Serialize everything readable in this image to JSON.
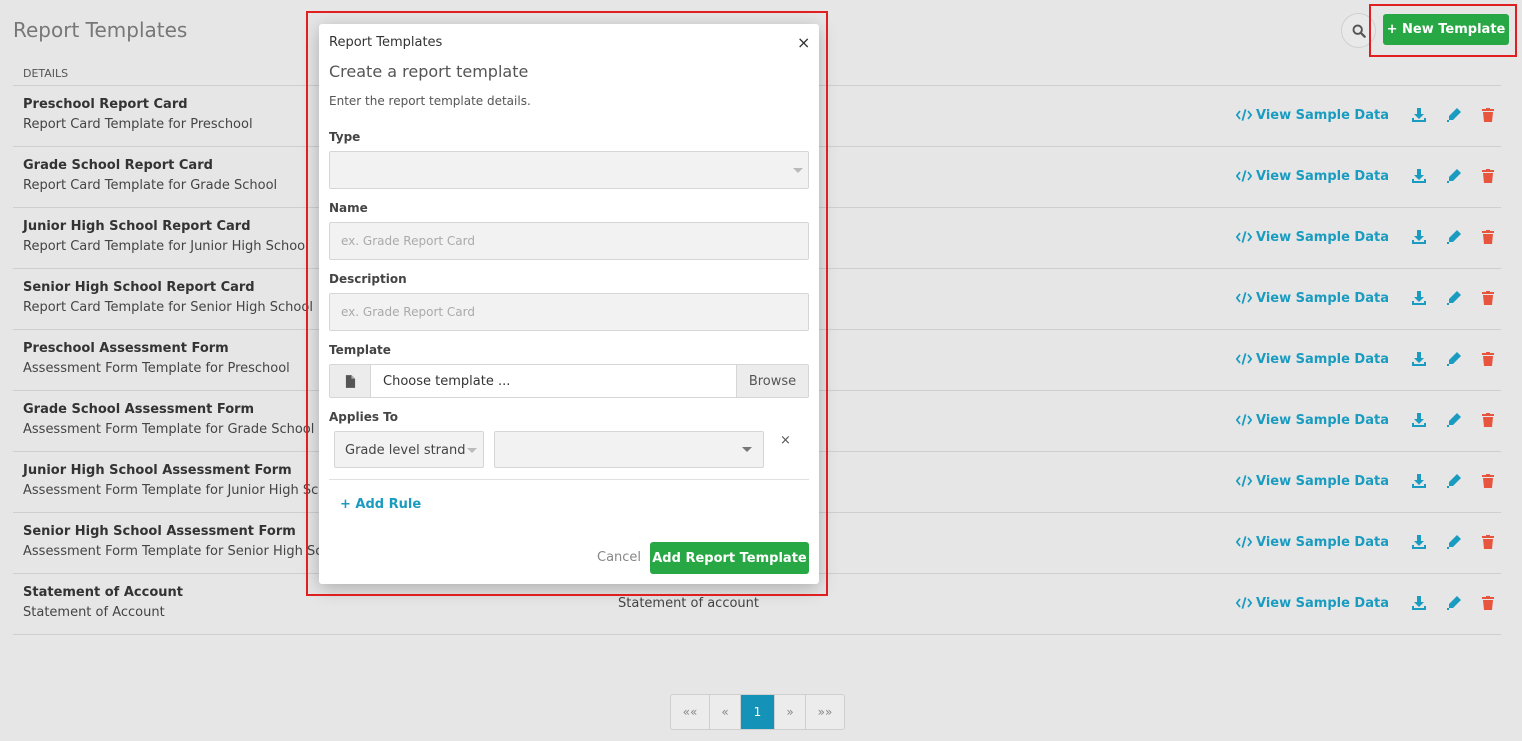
{
  "page": {
    "title": "Report Templates",
    "new_button": "+ New Template"
  },
  "table": {
    "header": "DETAILS",
    "view_sample_label": "View Sample Data",
    "rows": [
      {
        "name": "Preschool Report Card",
        "description": "Report Card Template for Preschool",
        "type": ""
      },
      {
        "name": "Grade School Report Card",
        "description": "Report Card Template for Grade School",
        "type": ""
      },
      {
        "name": "Junior High School Report Card",
        "description": "Report Card Template for Junior High School",
        "type": ""
      },
      {
        "name": "Senior High School Report Card",
        "description": "Report Card Template for Senior High School",
        "type": ""
      },
      {
        "name": "Preschool Assessment Form",
        "description": "Assessment Form Template for Preschool",
        "type": ""
      },
      {
        "name": "Grade School Assessment Form",
        "description": "Assessment Form Template for Grade School",
        "type": ""
      },
      {
        "name": "Junior High School Assessment Form",
        "description": "Assessment Form Template for Junior High School",
        "type": ""
      },
      {
        "name": "Senior High School Assessment Form",
        "description": "Assessment Form Template for Senior High School",
        "type": ""
      },
      {
        "name": "Statement of Account",
        "description": "Statement of Account",
        "type": "Statement of account"
      }
    ]
  },
  "pagination": {
    "first": "««",
    "prev": "«",
    "current": "1",
    "next": "»",
    "last": "»»"
  },
  "modal": {
    "header": "Report Templates",
    "close": "×",
    "title": "Create a report template",
    "subtitle": "Enter the report template details.",
    "type_label": "Type",
    "type_value": "",
    "name_label": "Name",
    "name_placeholder": "ex. Grade Report Card",
    "description_label": "Description",
    "description_placeholder": "ex. Grade Report Card",
    "template_label": "Template",
    "template_file_text": "Choose template ...",
    "browse_label": "Browse",
    "applies_to_label": "Applies To",
    "rule_field": "Grade level strand",
    "rule_value": "",
    "remove_rule": "×",
    "add_rule": "+ Add Rule",
    "cancel_label": "Cancel",
    "submit_label": "Add Report Template"
  },
  "colors": {
    "primary_green": "#28a745",
    "link_blue": "#1a9cc0",
    "danger": "#e8553e",
    "highlight": "#e02020",
    "page_active": "#1592b8"
  }
}
